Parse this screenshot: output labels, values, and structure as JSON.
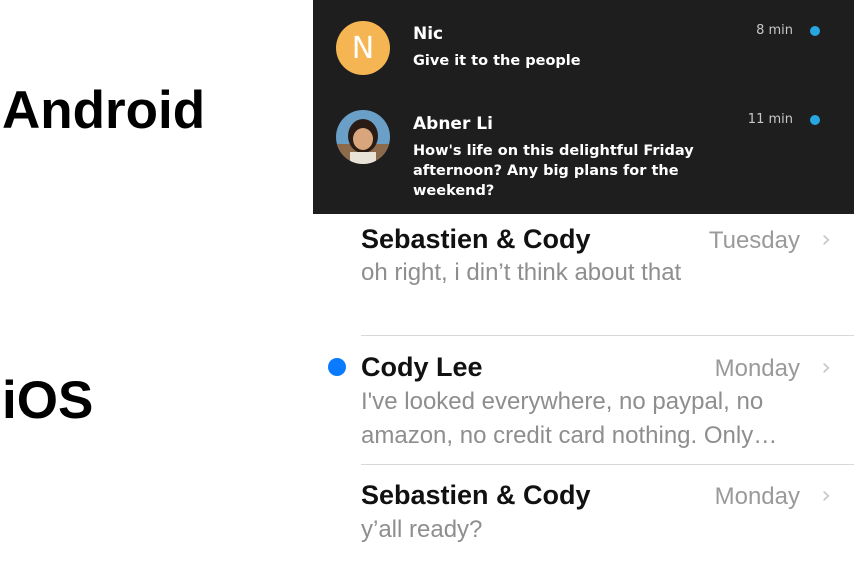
{
  "labels": {
    "android": "Android",
    "ios": "iOS"
  },
  "android": {
    "items": [
      {
        "name": "Nic",
        "avatar_letter": "N",
        "message": "Give it to the people",
        "time": "8 min"
      },
      {
        "name": "Abner Li",
        "avatar": "photo",
        "message": "How's life on this delightful Friday afternoon? Any big plans for the weekend?",
        "time": "11 min"
      }
    ],
    "accent": "#27a7e0",
    "background": "#1e1e1e"
  },
  "ios": {
    "rows": [
      {
        "name": "Sebastien & Cody",
        "date": "Tuesday",
        "preview": "oh right, i din’t think about that",
        "unread": false
      },
      {
        "name": "Cody Lee",
        "date": "Monday",
        "preview": "I've looked everywhere, no paypal, no amazon, no credit card nothing. Only…",
        "unread": true
      },
      {
        "name": "Sebastien & Cody",
        "date": "Monday",
        "preview": "y’all ready?",
        "unread": false
      }
    ],
    "chevron": "›",
    "unread_color": "#0a7aff"
  }
}
